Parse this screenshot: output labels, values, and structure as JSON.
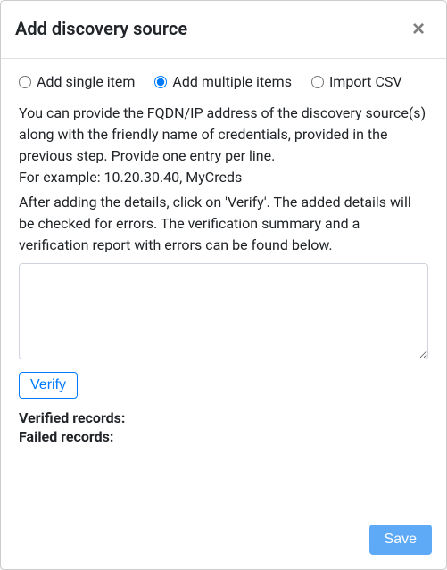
{
  "header": {
    "title": "Add discovery source",
    "close_label": "×"
  },
  "mode": {
    "selected": "multiple",
    "options": {
      "single": "Add single item",
      "multiple": "Add multiple items",
      "import": "Import CSV"
    }
  },
  "body": {
    "instructions1": "You can provide the FQDN/IP address of the discovery source(s) along with the friendly name of credentials, provided in the previous step. Provide one entry per line.",
    "example": "For example: 10.20.30.40, MyCreds",
    "instructions2": "After adding the details, click on 'Verify'. The added details will be checked for errors. The verification summary and a verification report with errors can be found below.",
    "textarea_value": "",
    "verify_label": "Verify",
    "verified_label": "Verified records:",
    "verified_value": "",
    "failed_label": "Failed records:",
    "failed_value": ""
  },
  "footer": {
    "save_label": "Save"
  }
}
